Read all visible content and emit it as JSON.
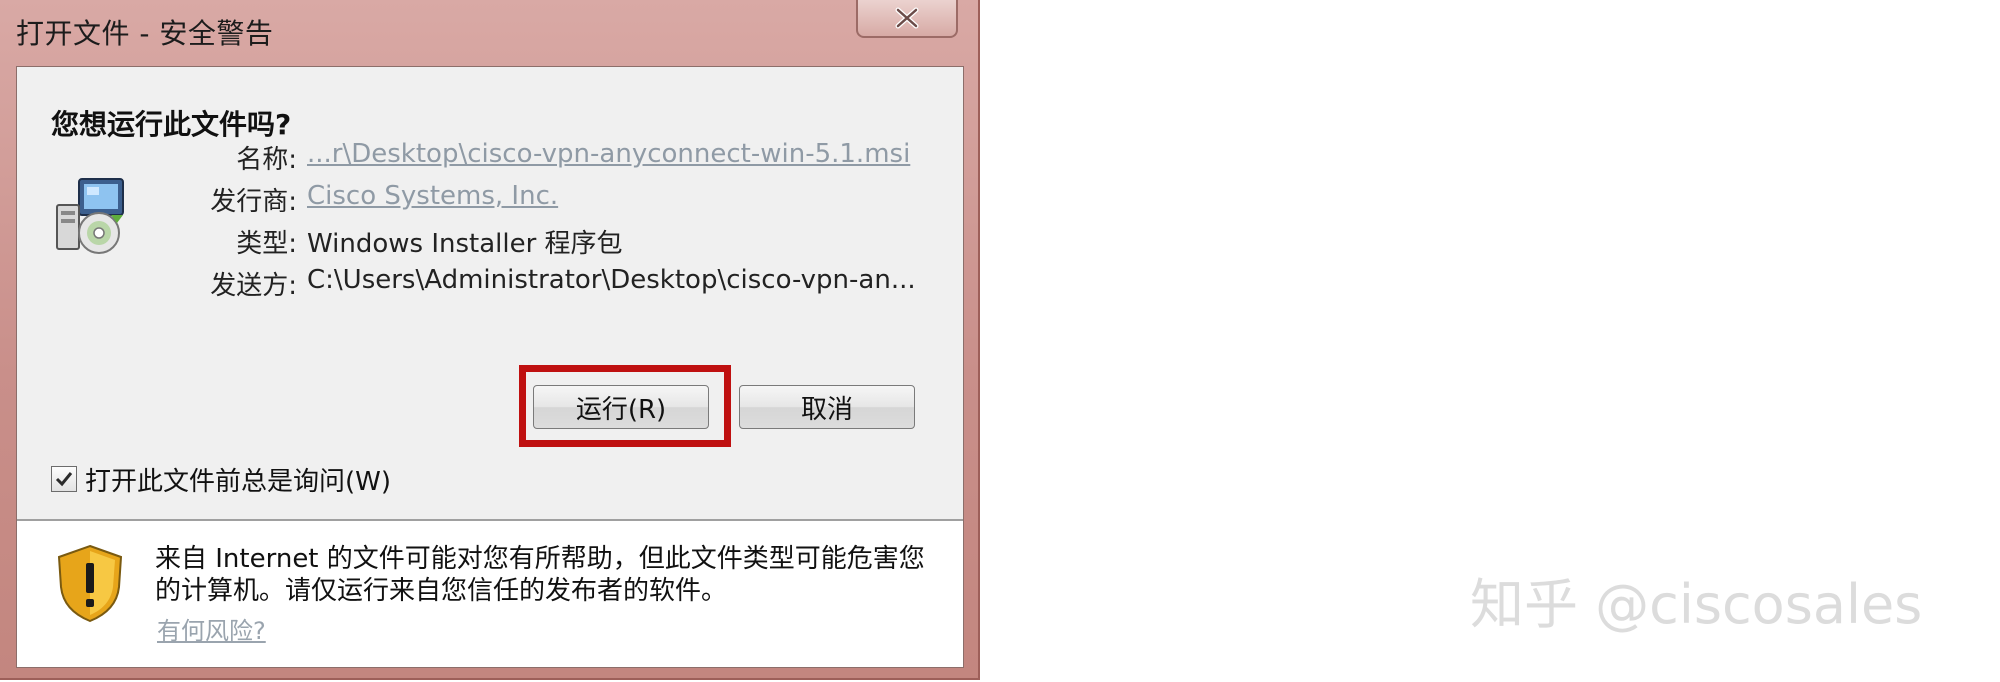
{
  "window": {
    "title": "打开文件 - 安全警告",
    "close_label": "X"
  },
  "dialog": {
    "question": "您想运行此文件吗?",
    "fields": [
      {
        "label": "名称:",
        "value": "...r\\Desktop\\cisco-vpn-anyconnect-win-5.1.msi",
        "is_link": true
      },
      {
        "label": "发行商:",
        "value": "Cisco Systems, Inc.",
        "is_link": true
      },
      {
        "label": "类型:",
        "value": "Windows Installer 程序包",
        "is_link": false
      },
      {
        "label": "发送方:",
        "value": "C:\\Users\\Administrator\\Desktop\\cisco-vpn-an...",
        "is_link": false
      }
    ],
    "buttons": {
      "run_label": "运行(R)",
      "cancel_label": "取消"
    },
    "checkbox": {
      "label": "打开此文件前总是询问(W)",
      "checked": true
    },
    "warning": {
      "text": "来自 Internet 的文件可能对您有所帮助，但此文件类型可能危害您的计算机。请仅运行来自您信任的发布者的软件。",
      "link_label": "有何风险?"
    },
    "icons": [
      "installer-icon",
      "shield-warning-icon",
      "close-icon",
      "checkmark-icon"
    ],
    "colors": {
      "frame": "#c98f8a",
      "highlight": "#bf1010",
      "link": "#8f9aa5"
    }
  },
  "watermark": {
    "text": "知乎 @ciscosales"
  }
}
